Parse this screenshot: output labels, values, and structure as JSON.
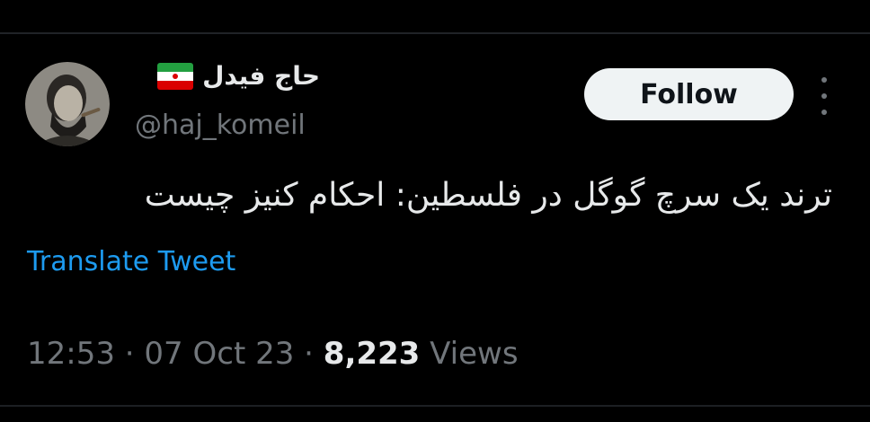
{
  "author": {
    "display_name": "حاج فیدل",
    "handle": "@haj_komeil",
    "flag_icon": "iran-flag-icon",
    "avatar_icon": "profile-photo-avatar"
  },
  "actions": {
    "follow_label": "Follow",
    "more_icon": "more-vertical-icon"
  },
  "tweet": {
    "text": "ترند یک سرچ گوگل در فلسطین: احکام کنیز چیست",
    "translate_label": "Translate Tweet"
  },
  "meta": {
    "time": "12:53",
    "separator_1": " · ",
    "date": "07 Oct 23",
    "separator_2": " · ",
    "views_count": "8,223",
    "views_label": " Views"
  },
  "colors": {
    "background": "#000000",
    "primary_text": "#e7e9ea",
    "secondary_text": "#71767b",
    "link": "#1d9bf0",
    "follow_bg": "#eff3f4"
  }
}
